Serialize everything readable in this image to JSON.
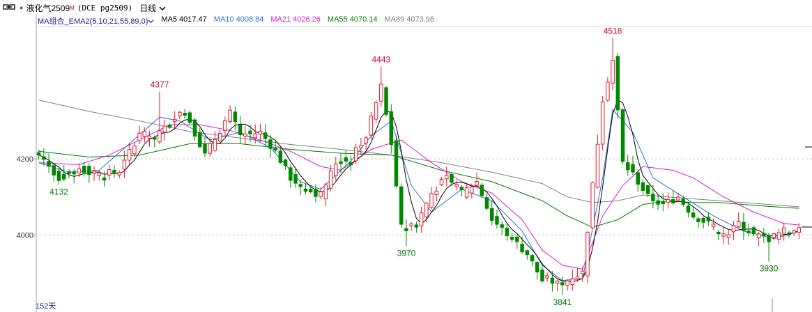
{
  "header": {
    "icon": "link-icon",
    "name": "液化气2509",
    "flag": "M",
    "code": "(DCE pg2509)",
    "period": "日线",
    "period_icon": "chevron-down-icon"
  },
  "ma_legend": {
    "combo_label": "MA组合_EMA2(5,10,21,55,89,0)",
    "items": [
      {
        "label": "MA5 4017.47",
        "color": "#000000"
      },
      {
        "label": "MA10 4008.84",
        "color": "#2a6fdb"
      },
      {
        "label": "MA21 4026.26",
        "color": "#d61ad6"
      },
      {
        "label": "MA55 4070.14",
        "color": "#007a00"
      },
      {
        "label": "MA89 4073.98",
        "color": "#808080"
      }
    ]
  },
  "footer": {
    "bar_count": "152天"
  },
  "colors": {
    "up": "#e0192a",
    "down": "#008800",
    "grid": "#c8c8c8",
    "axis": "#9aa0aa"
  },
  "chart_data": {
    "type": "candlestick",
    "y_ticks": [
      4000,
      4200
    ],
    "ylim": [
      3830,
      4545
    ],
    "bars": 152,
    "annotations": [
      {
        "bar": 24,
        "value": 4377,
        "text": "4377",
        "kind": "high"
      },
      {
        "bar": 4,
        "value": 4132,
        "text": "4132",
        "kind": "low"
      },
      {
        "bar": 68,
        "value": 4443,
        "text": "4443",
        "kind": "high"
      },
      {
        "bar": 73,
        "value": 3970,
        "text": "3970",
        "kind": "low"
      },
      {
        "bar": 104,
        "value": 3841,
        "text": "3841",
        "kind": "low"
      },
      {
        "bar": 114,
        "value": 4518,
        "text": "4518",
        "kind": "high"
      },
      {
        "bar": 145,
        "value": 3930,
        "text": "3930",
        "kind": "low"
      }
    ],
    "close_path": [
      [
        0,
        4215
      ],
      [
        4,
        4150
      ],
      [
        8,
        4175
      ],
      [
        12,
        4160
      ],
      [
        16,
        4165
      ],
      [
        20,
        4270
      ],
      [
        23,
        4250
      ],
      [
        28,
        4330
      ],
      [
        30,
        4300
      ],
      [
        33,
        4210
      ],
      [
        38,
        4320
      ],
      [
        40,
        4260
      ],
      [
        44,
        4270
      ],
      [
        47,
        4220
      ],
      [
        50,
        4150
      ],
      [
        53,
        4120
      ],
      [
        56,
        4105
      ],
      [
        59,
        4190
      ],
      [
        62,
        4200
      ],
      [
        65,
        4260
      ],
      [
        68,
        4390
      ],
      [
        70,
        4240
      ],
      [
        72,
        4020
      ],
      [
        75,
        4030
      ],
      [
        78,
        4110
      ],
      [
        81,
        4150
      ],
      [
        84,
        4110
      ],
      [
        87,
        4140
      ],
      [
        90,
        4040
      ],
      [
        94,
        3990
      ],
      [
        97,
        3950
      ],
      [
        100,
        3880
      ],
      [
        104,
        3870
      ],
      [
        106,
        3890
      ],
      [
        108,
        3900
      ],
      [
        110,
        4130
      ],
      [
        112,
        4360
      ],
      [
        114,
        4460
      ],
      [
        116,
        4190
      ],
      [
        118,
        4160
      ],
      [
        121,
        4100
      ],
      [
        124,
        4080
      ],
      [
        127,
        4100
      ],
      [
        130,
        4050
      ],
      [
        133,
        4030
      ],
      [
        136,
        3990
      ],
      [
        139,
        4030
      ],
      [
        142,
        4000
      ],
      [
        145,
        3990
      ],
      [
        148,
        4010
      ],
      [
        151,
        4010
      ]
    ],
    "moving_averages": [
      {
        "name": "MA89",
        "color": "#808080",
        "points": [
          [
            0,
            4355
          ],
          [
            10,
            4325
          ],
          [
            20,
            4300
          ],
          [
            30,
            4272
          ],
          [
            40,
            4255
          ],
          [
            50,
            4238
          ],
          [
            60,
            4225
          ],
          [
            70,
            4210
          ],
          [
            80,
            4190
          ],
          [
            90,
            4165
          ],
          [
            100,
            4135
          ],
          [
            105,
            4100
          ],
          [
            110,
            4085
          ],
          [
            115,
            4090
          ],
          [
            120,
            4105
          ],
          [
            125,
            4100
          ],
          [
            130,
            4095
          ],
          [
            135,
            4090
          ],
          [
            140,
            4085
          ],
          [
            145,
            4080
          ],
          [
            151,
            4074
          ]
        ]
      },
      {
        "name": "MA55",
        "color": "#007a00",
        "points": [
          [
            0,
            4220
          ],
          [
            10,
            4205
          ],
          [
            20,
            4210
          ],
          [
            30,
            4240
          ],
          [
            40,
            4240
          ],
          [
            50,
            4225
          ],
          [
            60,
            4215
          ],
          [
            70,
            4210
          ],
          [
            80,
            4170
          ],
          [
            90,
            4140
          ],
          [
            100,
            4090
          ],
          [
            105,
            4050
          ],
          [
            110,
            4020
          ],
          [
            115,
            4040
          ],
          [
            120,
            4080
          ],
          [
            125,
            4090
          ],
          [
            130,
            4085
          ],
          [
            135,
            4085
          ],
          [
            140,
            4080
          ],
          [
            145,
            4075
          ],
          [
            151,
            4070
          ]
        ]
      },
      {
        "name": "MA21",
        "color": "#d61ad6",
        "points": [
          [
            0,
            4190
          ],
          [
            8,
            4185
          ],
          [
            14,
            4210
          ],
          [
            20,
            4250
          ],
          [
            26,
            4290
          ],
          [
            32,
            4290
          ],
          [
            38,
            4275
          ],
          [
            44,
            4250
          ],
          [
            50,
            4220
          ],
          [
            56,
            4180
          ],
          [
            60,
            4170
          ],
          [
            66,
            4225
          ],
          [
            72,
            4250
          ],
          [
            78,
            4190
          ],
          [
            84,
            4140
          ],
          [
            90,
            4110
          ],
          [
            96,
            4040
          ],
          [
            100,
            3960
          ],
          [
            104,
            3920
          ],
          [
            108,
            3910
          ],
          [
            112,
            4050
          ],
          [
            116,
            4130
          ],
          [
            120,
            4180
          ],
          [
            126,
            4170
          ],
          [
            130,
            4150
          ],
          [
            136,
            4100
          ],
          [
            142,
            4060
          ],
          [
            148,
            4030
          ],
          [
            151,
            4026
          ]
        ]
      },
      {
        "name": "MA10",
        "color": "#2a6fdb",
        "points": [
          [
            0,
            4190
          ],
          [
            6,
            4165
          ],
          [
            12,
            4170
          ],
          [
            18,
            4240
          ],
          [
            24,
            4310
          ],
          [
            28,
            4300
          ],
          [
            34,
            4250
          ],
          [
            40,
            4270
          ],
          [
            46,
            4230
          ],
          [
            52,
            4140
          ],
          [
            56,
            4120
          ],
          [
            62,
            4195
          ],
          [
            66,
            4260
          ],
          [
            70,
            4300
          ],
          [
            74,
            4130
          ],
          [
            78,
            4060
          ],
          [
            84,
            4120
          ],
          [
            90,
            4090
          ],
          [
            96,
            4010
          ],
          [
            100,
            3920
          ],
          [
            104,
            3880
          ],
          [
            108,
            3885
          ],
          [
            112,
            4150
          ],
          [
            114,
            4330
          ],
          [
            118,
            4270
          ],
          [
            122,
            4150
          ],
          [
            128,
            4100
          ],
          [
            134,
            4050
          ],
          [
            140,
            4010
          ],
          [
            146,
            3990
          ],
          [
            151,
            4009
          ]
        ]
      }
    ]
  }
}
